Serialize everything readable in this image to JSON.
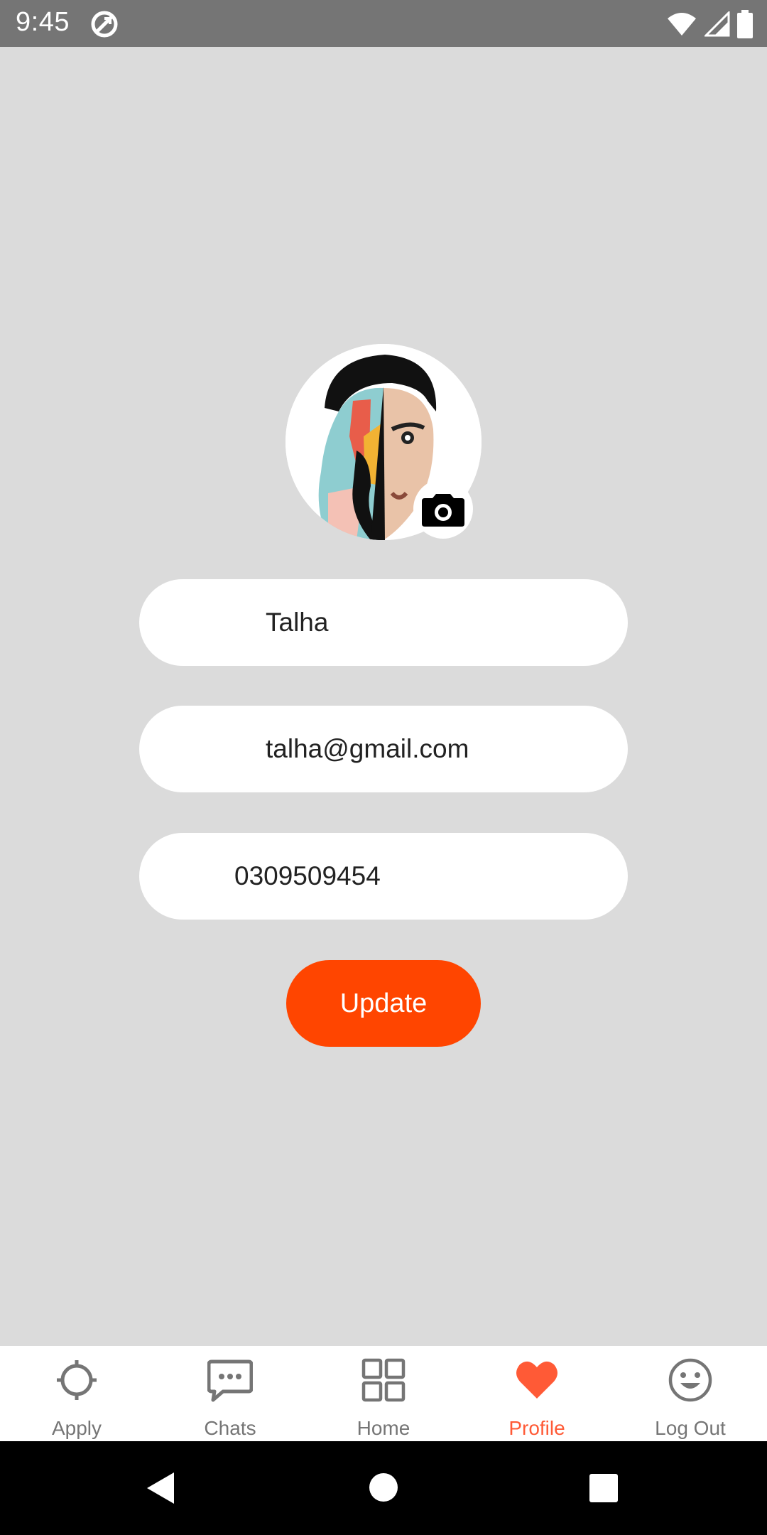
{
  "status_bar": {
    "time": "9:45"
  },
  "profile": {
    "name_value": "Talha",
    "email_value": "talha@gmail.com",
    "phone_value": "0309509454",
    "update_label": "Update"
  },
  "bottom_nav": {
    "items": [
      {
        "label": "Apply",
        "icon": "crosshair-icon"
      },
      {
        "label": "Chats",
        "icon": "chat-bubble-icon"
      },
      {
        "label": "Home",
        "icon": "grid-icon"
      },
      {
        "label": "Profile",
        "icon": "heart-icon",
        "active": true
      },
      {
        "label": "Log Out",
        "icon": "smiley-icon"
      }
    ]
  },
  "colors": {
    "background": "#dbdbdb",
    "accent": "#ff4500",
    "active_nav": "#ff5a36",
    "inactive_nav": "#757575",
    "status_bar": "#757575"
  }
}
